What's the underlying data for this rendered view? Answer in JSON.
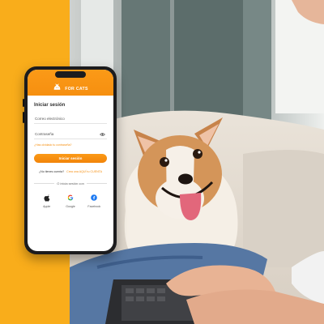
{
  "app": {
    "brand": "FOR CATS"
  },
  "login": {
    "title": "Iniciar sesión",
    "email_placeholder": "Correo electrónico",
    "password_placeholder": "Contraseña",
    "forgot_password": "¿Has olvidado tu contraseña?",
    "submit_label": "Iniciar sesión",
    "no_account_question": "¿No tienes cuenta?",
    "create_account_link": "Crea una AQUÍ tu CUENTA",
    "divider_text": "O inicia sesión con"
  },
  "social": {
    "items": [
      {
        "label": "Apple",
        "icon": "apple-icon"
      },
      {
        "label": "Google",
        "icon": "google-icon"
      },
      {
        "label": "Facebook",
        "icon": "facebook-icon"
      }
    ]
  },
  "colors": {
    "accent": "#f68f10",
    "background_band": "#f9ad1b",
    "facebook": "#1877f2"
  },
  "background": {
    "icon": "corgi-photo"
  }
}
